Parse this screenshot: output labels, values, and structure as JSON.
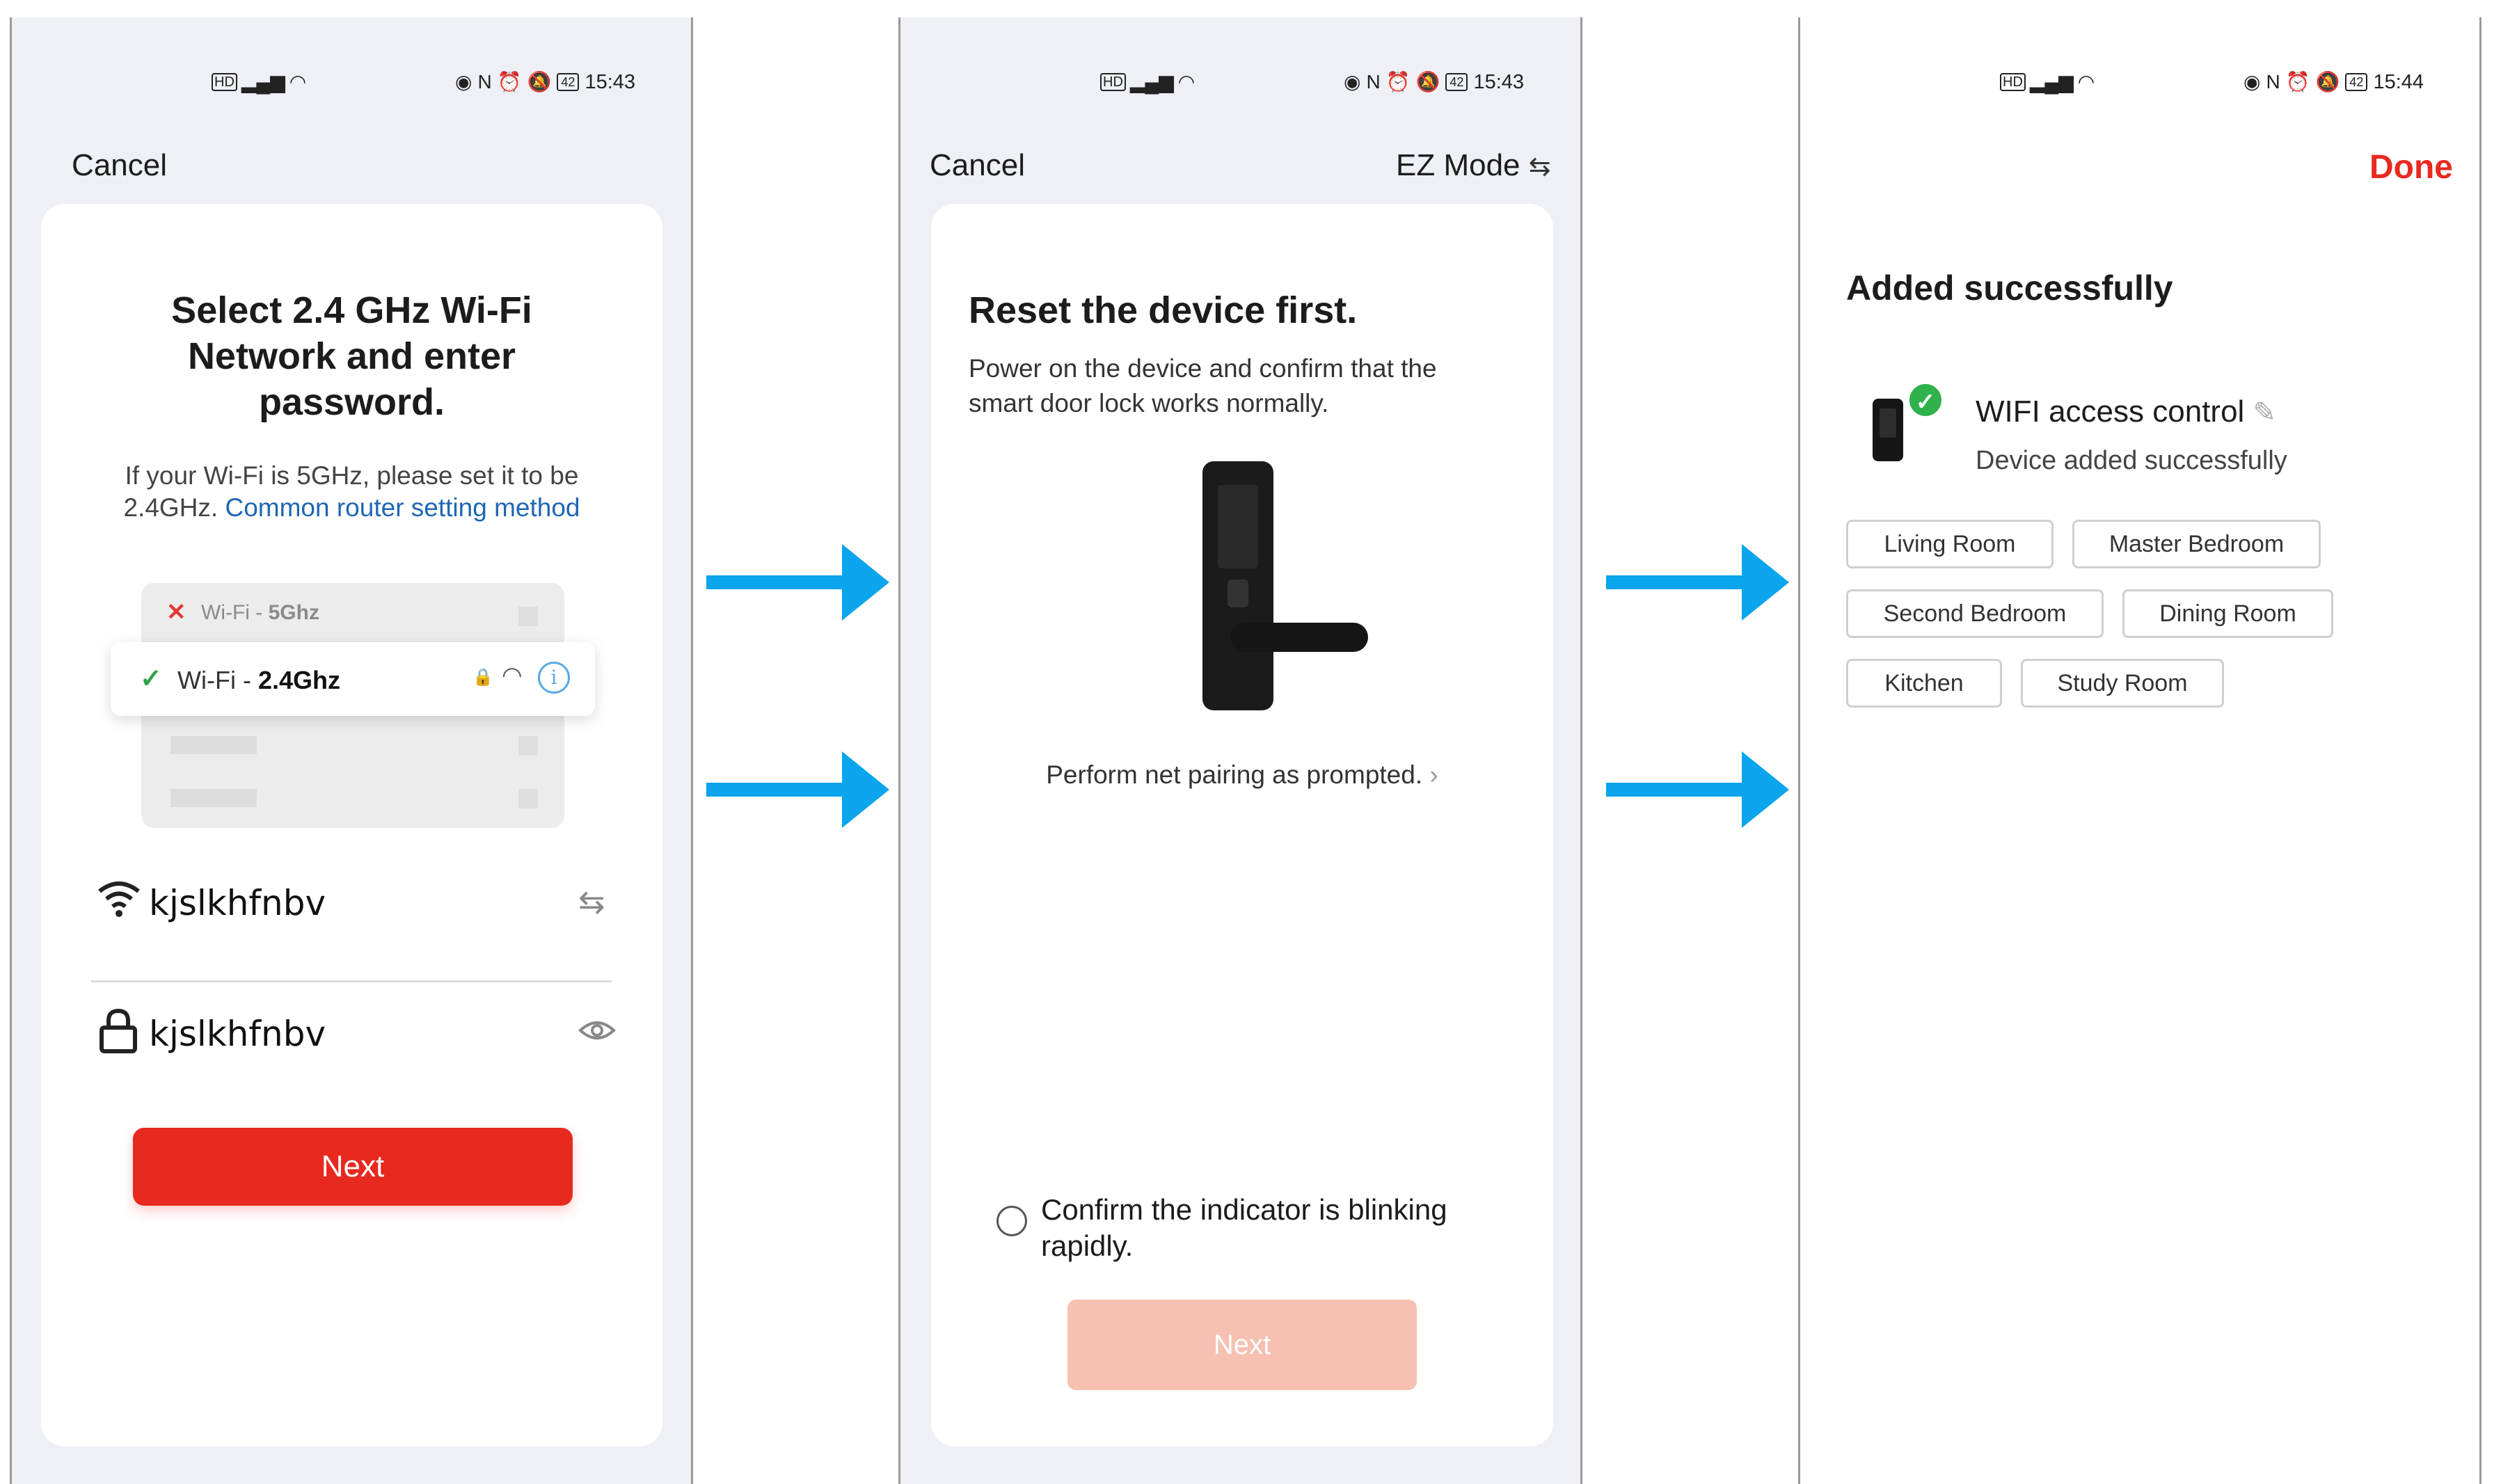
{
  "status_bar": {
    "left_icons": [
      "hd-icon",
      "signal-icon",
      "wifi-icon"
    ],
    "right_icons": [
      "eye-icon",
      "nfc-icon",
      "alarm-icon",
      "mute-icon",
      "battery-icon"
    ],
    "battery": "42",
    "time_1": "15:43",
    "time_2": "15:43",
    "time_3": "15:44"
  },
  "screen1": {
    "cancel": "Cancel",
    "title_line1": "Select 2.4 GHz Wi-Fi",
    "title_line2": "Network and enter",
    "title_line3": "password.",
    "hint_line1": "If your Wi-Fi is 5GHz, please set it to be",
    "hint_prefix": "2.4GHz.",
    "hint_link": "Common router setting method",
    "illustration": {
      "row1_label": "Wi-Fi - ",
      "row1_band": "5Ghz",
      "row2_label": "Wi-Fi - ",
      "row2_band": "2.4Ghz"
    },
    "ssid_value": "kjslkhfnbv",
    "password_value": "kjslkhfnbv",
    "next_button": "Next",
    "colors": {
      "accent": "#e7291f",
      "link": "#1f66b4",
      "bg": "#eef0f5"
    }
  },
  "screen2": {
    "cancel": "Cancel",
    "mode": "EZ Mode",
    "title": "Reset the device first.",
    "desc_line1": "Power on the device and confirm that the",
    "desc_line2": "smart door lock works normally.",
    "prompt_link": "Perform net pairing as prompted.",
    "confirm_line1": "Confirm the indicator is blinking",
    "confirm_line2": "rapidly.",
    "next_button": "Next",
    "colors": {
      "next_disabled": "#f6c1b2"
    }
  },
  "screen3": {
    "done": "Done",
    "title": "Added successfully",
    "device_name": "WIFI access control",
    "device_status": "Device added successfully",
    "rooms": [
      "Living Room",
      "Master Bedroom",
      "Second Bedroom",
      "Dining Room",
      "Kitchen",
      "Study Room"
    ],
    "colors": {
      "done": "#e7291f",
      "success": "#2fb14c"
    }
  },
  "arrows": {
    "color": "#0aa5ec"
  }
}
